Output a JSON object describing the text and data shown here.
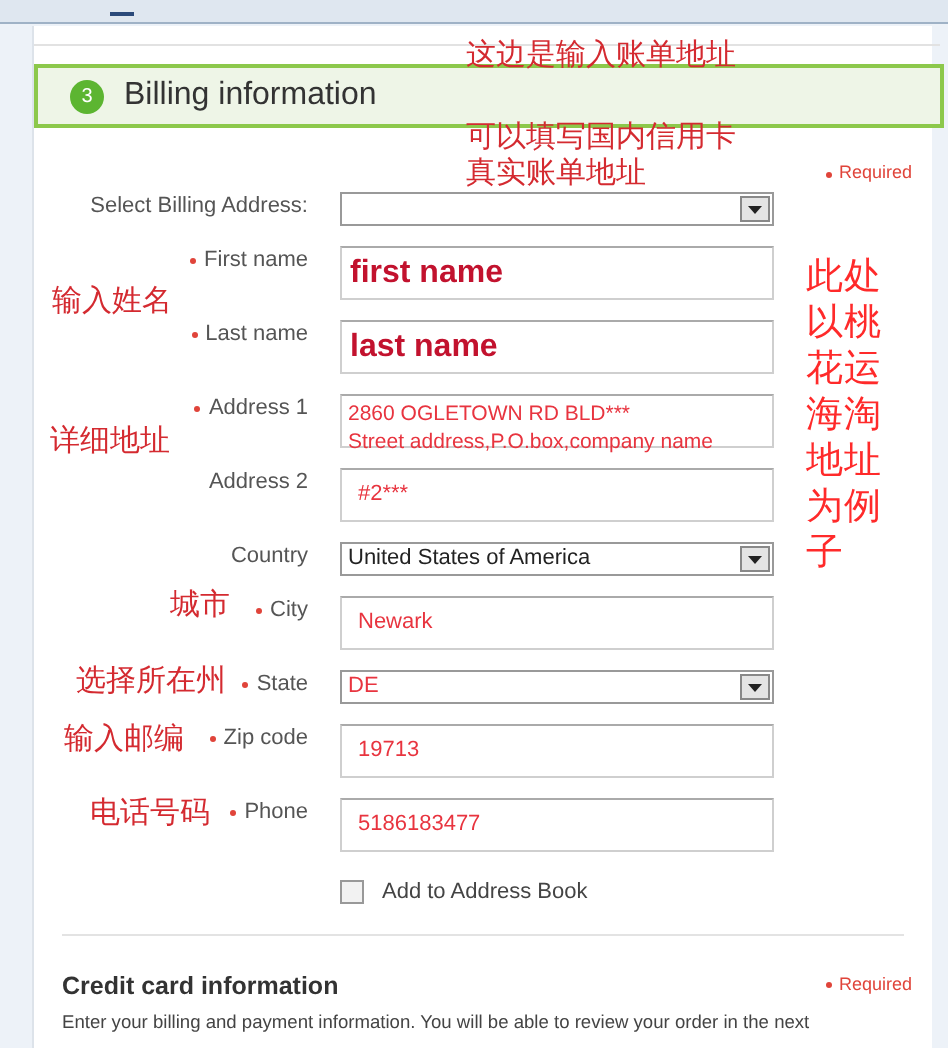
{
  "section": {
    "step": "3",
    "title": "Billing information"
  },
  "required_note": "Required",
  "fields": [
    {
      "label": "Select Billing Address:",
      "required": false,
      "kind": "select"
    },
    {
      "label": "First name",
      "required": true,
      "kind": "text-large",
      "value": "first name",
      "highlighted": true
    },
    {
      "label": "Last name",
      "required": true,
      "kind": "text-large",
      "value": "last name",
      "highlighted": true
    },
    {
      "label": "Address 1",
      "required": true,
      "kind": "multiline",
      "lines": [
        "2860 OGLETOWN RD BLD***",
        "Street address,P.O.box,company name"
      ],
      "highlighted": true
    },
    {
      "label": "Address 2",
      "required": false,
      "kind": "text",
      "value": "#2***",
      "highlighted": true
    },
    {
      "label": "Country",
      "required": false,
      "kind": "select",
      "value": "United States of America",
      "highlighted": false
    },
    {
      "label": "City",
      "required": true,
      "kind": "text",
      "value": "Newark",
      "highlighted": true
    },
    {
      "label": "State",
      "required": true,
      "kind": "select",
      "value": "DE",
      "highlighted": true
    },
    {
      "label": "Zip code",
      "required": true,
      "kind": "text",
      "value": "19713",
      "highlighted": true
    },
    {
      "label": "Phone",
      "required": true,
      "kind": "text",
      "value": "5186183477",
      "highlighted": true
    },
    {
      "label": "Add to Address Book",
      "kind": "checkbox",
      "checked": false
    }
  ],
  "credit_card": {
    "title": "Credit card information",
    "required_note": "Required",
    "text": "Enter your billing and payment information. You will be able to review your order in the next"
  },
  "annotations": [
    {
      "kind": "horizontal",
      "lines": [
        "这边是输入账单地址"
      ]
    },
    {
      "kind": "horizontal",
      "lines": [
        "可以填写国内信用卡",
        "真实账单地址"
      ]
    },
    {
      "kind": "vertical",
      "lines": [
        "此处以桃花运海淘地址为例子"
      ]
    },
    {
      "kind": "horizontal",
      "lines": [
        "输入姓名"
      ]
    },
    {
      "kind": "horizontal",
      "lines": [
        "详细地址"
      ]
    },
    {
      "kind": "horizontal",
      "lines": [
        "城市"
      ]
    },
    {
      "kind": "horizontal",
      "lines": [
        "选择所在州"
      ]
    },
    {
      "kind": "horizontal",
      "lines": [
        "输入邮编"
      ]
    },
    {
      "kind": "horizontal",
      "lines": [
        "电话号码"
      ]
    }
  ]
}
